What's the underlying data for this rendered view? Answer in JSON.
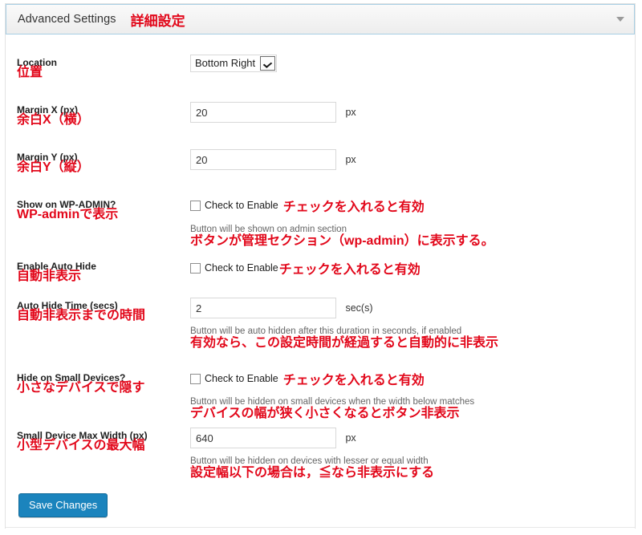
{
  "accordion": {
    "title_en": "Advanced Settings",
    "title_jp": "詳細設定",
    "arrow_icon": "chevron-down-icon"
  },
  "colors": {
    "annotation_red": "#e2071a",
    "header_border": "#a8cfe4",
    "save_button_bg": "#1b84bd",
    "help_text": "#666666"
  },
  "fields": {
    "location": {
      "label_en": "Location",
      "label_jp": "位置",
      "selected": "Bottom Right",
      "options": [
        "Bottom Right"
      ]
    },
    "margin_x": {
      "label_en": "Margin X (px)",
      "label_jp": "余白X（横）",
      "value": "20",
      "unit": "px"
    },
    "margin_y": {
      "label_en": "Margin Y (px)",
      "label_jp": "余白Y（縦）",
      "value": "20",
      "unit": "px"
    },
    "show_on_wp_admin": {
      "label_en": "Show on WP-ADMIN?",
      "label_jp": "WP-adminで表示",
      "checkbox_label_en": "Check to Enable",
      "checkbox_label_jp": "チェックを入れると有効",
      "checked": false,
      "help_en": "Button will be shown on admin section",
      "help_jp": "ボタンが管理セクション（wp-admin）に表示する。"
    },
    "enable_auto_hide": {
      "label_en": "Enable Auto Hide",
      "label_jp": "自動非表示",
      "checkbox_label_en": "Check to Enable",
      "checkbox_label_jp": "チェックを入れると有効",
      "checked": false
    },
    "auto_hide_time": {
      "label_en": "Auto Hide Time (secs)",
      "label_jp": "自動非表示までの時間",
      "value": "2",
      "unit": "sec(s)",
      "help_en": "Button will be auto hidden after this duration in seconds, if enabled",
      "help_jp": "有効なら、この設定時間が経過すると自動的に非表示"
    },
    "hide_on_small_devices": {
      "label_en": "Hide on Small Devices?",
      "label_jp": "小さなデバイスで隠す",
      "checkbox_label_en": "Check to Enable",
      "checkbox_label_jp": "チェックを入れると有効",
      "checked": false,
      "help_en": "Button will be hidden on small devices when the width below matches",
      "help_jp": "デバイスの幅が狭く小さくなるとボタン非表示"
    },
    "small_device_max_width": {
      "label_en": "Small Device Max Width (px)",
      "label_jp": "小型デバイスの最大幅",
      "value": "640",
      "unit": "px",
      "help_en": "Button will be hidden on devices with lesser or equal width",
      "help_jp": "設定幅以下の場合は，≦なら非表示にする"
    }
  },
  "actions": {
    "save_label": "Save Changes"
  }
}
